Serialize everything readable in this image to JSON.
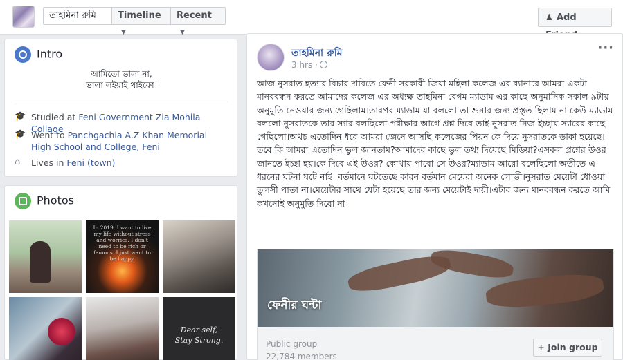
{
  "topbar": {
    "profile_name": "তাহমিনা রুমি",
    "timeline_label": "Timeline",
    "recent_label": "Recent",
    "add_friend_label": "Add Friend"
  },
  "intro": {
    "title": "Intro",
    "bio_line1": "আমিতো ভালা না,",
    "bio_line2": "ভালা লইয়াই থাইকো।",
    "studied_prefix": "Studied at ",
    "studied_link": "Feni Government Zia Mohila Collage",
    "went_prefix": "Went to ",
    "went_link": "Panchgachia A.Z Khan Memorial High School and College, Feni",
    "lives_prefix": "Lives in ",
    "lives_link": "Feni (town)"
  },
  "photos": {
    "title": "Photos",
    "photo2_caption": "In 2019, I want to live my life without stress and worries. I don't need to be rich or famous. I just want to be happy.",
    "photo6_caption_line1": "Dear self,",
    "photo6_caption_line2": "Stay Strong."
  },
  "post": {
    "author": "তাহমিনা রুমি",
    "time": "3 hrs ·",
    "more": "···",
    "text": "আজ নুসরাত হত্যার বিচার দাবিতে ফেনী সরকারী জিয়া মহিলা কলেজ এর ব্যানারে আমরা একটা মানববন্ধন করতে আমাদের কলেজ এর অধ্যক্ষ তাহমিনা বেগম ম্যাডাম এর কাছে অনুমানিক সকাল ৯টায় অনুমুতি নেওয়ার জন্য গেছিলাম।তারপর ম্যাডাম যা বললো তা শুনার জন্য প্রস্তুত ছিলাম না কেউ।ম্যাডাম বললো নুসরাতকে তার স্যার বলছিলো পরীক্ষার আগে প্রশ্ন দিবে তাই নুসরাত নিজ ইচ্ছায় স্যারের কাছে গেছিলো।অথচ এতোদিন ধরে আমরা জেনে আসছি কলেজের পিয়ন কে দিয়ে নুসরাতকে ডাকা হয়েছে।তবে কি আমরা এতোদিন ভুল জানতাম?আমাদের কাছে ভুল তথ্য দিয়েছে মিডিয়া?এসকল প্রশ্নের উওর জানতে ইচ্ছা হয়।কে দিবে এই উওর? কোথায় পাবো সে উওর?ম্যাডাম আরো বলেছিলো অতীতে এ ধরনের ঘটনা ঘটে নাই। বর্তমানে ঘটতেছে।কারন বর্তমান মেয়েরা অনেক লোভী।নুসরাত মেয়েটা ধোওয়া তুলসী পাতা না।মেয়েটার সাথে যেটা হয়েছে তার জন্য মেয়েটাই দায়ী।এটার জন্য মানববন্ধন করতে আমি কখনোই অনুমুতি দিবো না",
    "attachment": {
      "title": "ফেনীর ঘন্টা",
      "type": "Public group",
      "members": "22,784 members",
      "join_label": "Join group"
    }
  }
}
